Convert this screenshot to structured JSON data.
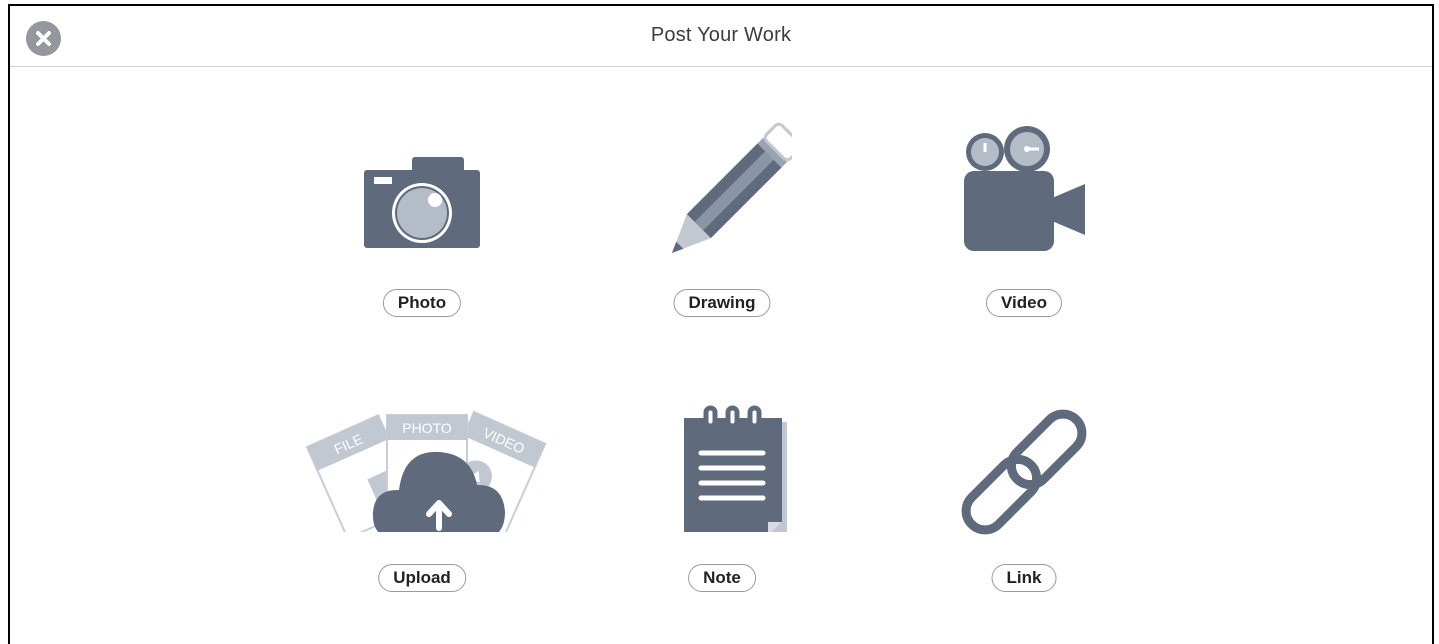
{
  "header": {
    "title": "Post Your Work",
    "close_icon": "close-icon"
  },
  "options": [
    {
      "id": "photo",
      "label": "Photo",
      "icon": "camera-icon"
    },
    {
      "id": "drawing",
      "label": "Drawing",
      "icon": "pencil-icon"
    },
    {
      "id": "video",
      "label": "Video",
      "icon": "video-camera-icon"
    },
    {
      "id": "upload",
      "label": "Upload",
      "icon": "upload-cloud-icon",
      "card_labels": [
        "FILE",
        "PHOTO",
        "VIDEO"
      ]
    },
    {
      "id": "note",
      "label": "Note",
      "icon": "notepad-icon"
    },
    {
      "id": "link",
      "label": "Link",
      "icon": "link-icon"
    }
  ],
  "colors": {
    "icon_dark": "#5f6b7c",
    "icon_light": "#c2c8d2",
    "close_bg": "#94979e"
  }
}
